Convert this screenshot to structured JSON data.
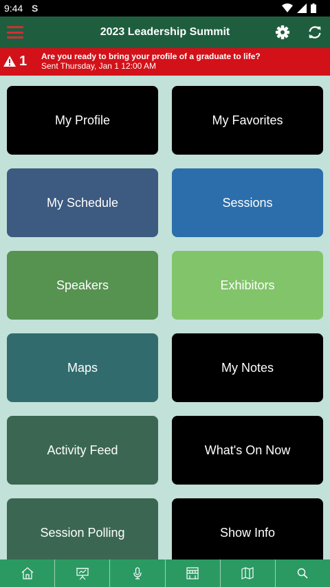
{
  "status_bar": {
    "time": "9:44",
    "notification_icon": "S"
  },
  "app_bar": {
    "title": "2023 Leadership Summit"
  },
  "alert": {
    "count": "1",
    "message": "Are you ready to bring your profile of a graduate to life?",
    "sent": "Sent Thursday, Jan 1 12:00 AM"
  },
  "tiles": [
    {
      "label": "My Profile",
      "color": "#000000"
    },
    {
      "label": "My Favorites",
      "color": "#000000"
    },
    {
      "label": "My Schedule",
      "color": "#3d5a80"
    },
    {
      "label": "Sessions",
      "color": "#2c6eab"
    },
    {
      "label": "Speakers",
      "color": "#569250"
    },
    {
      "label": "Exhibitors",
      "color": "#82c46a"
    },
    {
      "label": "Maps",
      "color": "#316b6d"
    },
    {
      "label": "My Notes",
      "color": "#000000"
    },
    {
      "label": "Activity Feed",
      "color": "#3b6752"
    },
    {
      "label": "What's On Now",
      "color": "#000000"
    },
    {
      "label": "Session Polling",
      "color": "#3b6752"
    },
    {
      "label": "Show Info",
      "color": "#000000"
    }
  ],
  "tabs": [
    {
      "icon": "home-icon"
    },
    {
      "icon": "presentation-icon"
    },
    {
      "icon": "microphone-icon"
    },
    {
      "icon": "exhibitor-booth-icon"
    },
    {
      "icon": "map-icon"
    },
    {
      "icon": "search-icon"
    }
  ],
  "colors": {
    "app_bar": "#1f5d3f",
    "alert": "#d31119",
    "background": "#c2e1d8",
    "tab_bar": "#2b9a62",
    "menu_icon": "#d0302f"
  }
}
